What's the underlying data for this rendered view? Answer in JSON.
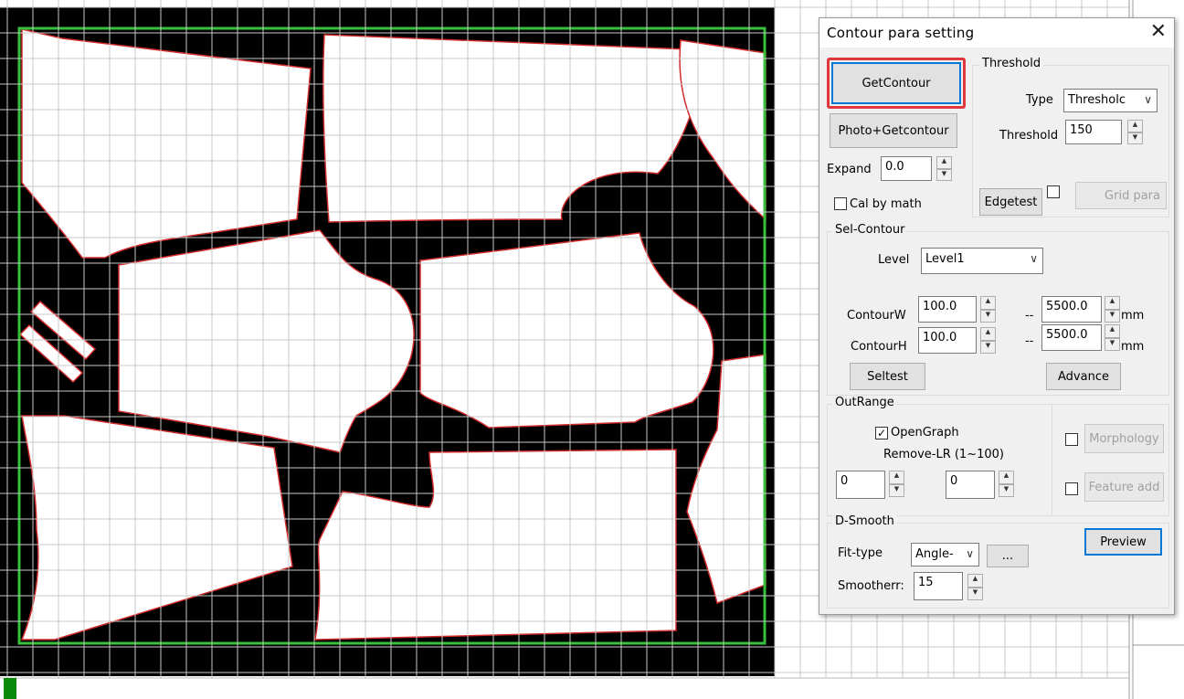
{
  "dialog": {
    "title": "Contour para setting",
    "close_glyph": "✕",
    "getcontour_label": "GetContour",
    "photo_getcontour_label": "Photo+Getcontour",
    "expand_label": "Expand",
    "expand_value": "0.0",
    "cal_by_math_label": "Cal by math",
    "cal_by_math_checked": false
  },
  "threshold": {
    "group_label": "Threshold",
    "type_label": "Type",
    "type_value": "Thresholc",
    "threshold_label": "Threshold",
    "threshold_value": "150",
    "edgetest_label": "Edgetest",
    "grid_para_label": "Grid para"
  },
  "sel_contour": {
    "group_label": "Sel-Contour",
    "level_label": "Level",
    "level_value": "Level1",
    "contour_w_label": "ContourW",
    "contour_w_min": "100.0",
    "contour_w_max": "5500.0",
    "contour_h_label": "ContourH",
    "contour_h_min": "100.0",
    "contour_h_max": "5500.0",
    "range_sep": "--",
    "unit": "mm",
    "seltest_label": "Seltest",
    "advance_label": "Advance"
  },
  "out_range": {
    "group_label": "OutRange",
    "open_graph_label": "OpenGraph",
    "open_graph_checked": true,
    "remove_lr_label": "Remove-LR  (1~100)",
    "remove_l_value": "0",
    "remove_r_value": "0",
    "morphology_label": "Morphology",
    "feature_add_label": "Feature add"
  },
  "d_smooth": {
    "group_label": "D-Smooth",
    "fit_type_label": "Fit-type",
    "fit_type_value": "Angle-",
    "more_label": "...",
    "smootherr_label": "Smootherr:",
    "smootherr_value": "15",
    "preview_label": "Preview"
  },
  "icons": {
    "spin_up": "▲",
    "spin_down": "▼",
    "chevron": "∨",
    "check": "✓"
  },
  "colors": {
    "canvas_background": "#000000",
    "work_area_border": "#36c03c",
    "contour_outline": "#d12b2b",
    "grid_line": "#c8c8c8",
    "highlight": "#e0373f",
    "focus_border": "#0078d7"
  }
}
